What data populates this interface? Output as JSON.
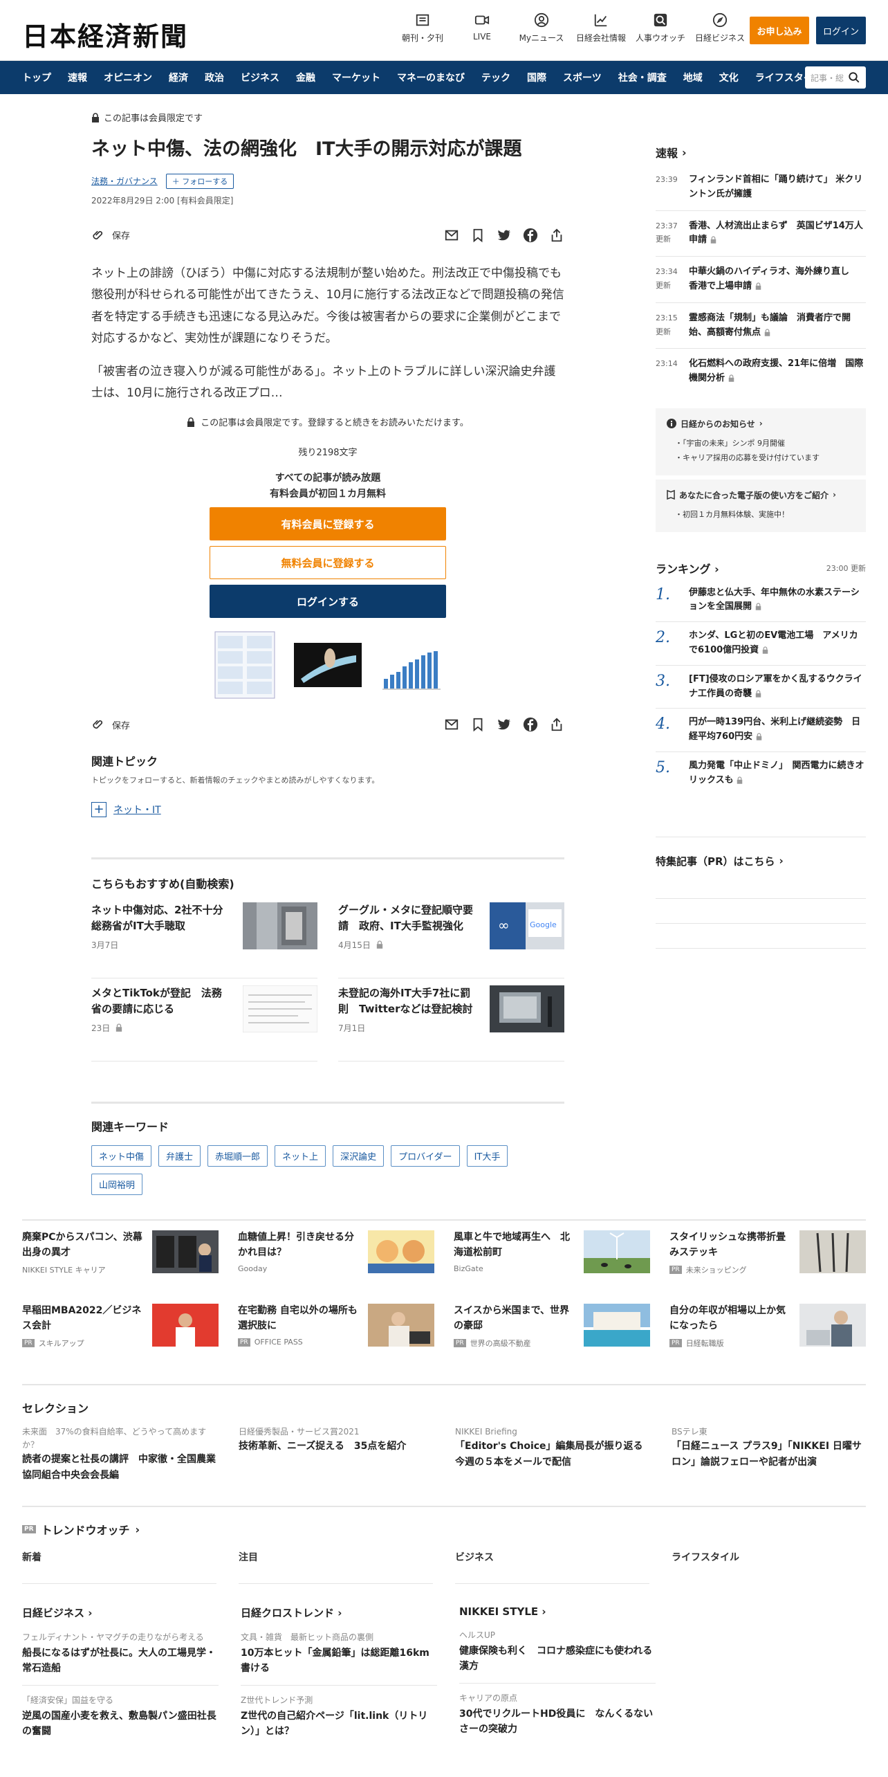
{
  "header": {
    "logo": "日本経済新聞",
    "icons": [
      {
        "icon": "newspaper-icon",
        "label": "朝刊・夕刊"
      },
      {
        "icon": "video-icon",
        "label": "LIVE"
      },
      {
        "icon": "user-icon",
        "label": "Myニュース"
      },
      {
        "icon": "chart-icon",
        "label": "日経会社情報"
      },
      {
        "icon": "search-person-icon",
        "label": "人事ウオッチ"
      },
      {
        "icon": "compass-icon",
        "label": "日経ビジネス"
      }
    ],
    "subscribe_label": "お申し込み",
    "login_label": "ログイン"
  },
  "nav": {
    "items": [
      "トップ",
      "速報",
      "オピニオン",
      "経済",
      "政治",
      "ビジネス",
      "金融",
      "マーケット",
      "マネーのまなび",
      "テック",
      "国際",
      "スポーツ",
      "社会・調査",
      "地域",
      "文化",
      "ライフスタイル"
    ],
    "search_placeholder": "記事・総"
  },
  "article": {
    "members_label": "この記事は会員限定です",
    "title": "ネット中傷、法の網強化　IT大手の開示対応が課題",
    "tag": "法務・ガバナンス",
    "follow_label": "フォローする",
    "date": "2022年8月29日 2:00 [有料会員限定]",
    "save_label": "保存",
    "para1": "ネット上の誹謗（ひぼう）中傷に対応する法規制が整い始めた。刑法改正で中傷投稿でも懲役刑が科せられる可能性が出てきたうえ、10月に施行する法改正などで問題投稿の発信者を特定する手続きも迅速になる見込みだ。今後は被害者からの要求に企業側がどこまで対応するかなど、実効性が課題になりそうだ。",
    "para2": "「被害者の泣き寝入りが減る可能性がある」。ネット上のトラブルに詳しい深沢論史弁護士は、10月に施行される改正プロ…",
    "paywall_note": "この記事は会員限定です。登録すると続きをお読みいただけます。",
    "remaining": "残り2198文字",
    "lead1": "すべての記事が読み放題",
    "lead2": "有料会員が初回１カ月無料",
    "btn_paid": "有料会員に登録する",
    "btn_free": "無料会員に登録する",
    "btn_login": "ログインする"
  },
  "topics": {
    "heading": "関連トピック",
    "desc": "トピックをフォローすると、新着情報のチェックやまとめ読みがしやすくなります。",
    "item": "ネット・IT"
  },
  "recommend": {
    "heading": "こちらもおすすめ(自動検索)",
    "items": [
      {
        "title": "ネット中傷対応、2社不十分　総務省がIT大手聴取",
        "date": "3月7日",
        "lock": false
      },
      {
        "title": "グーグル・メタに登記順守要請　政府、IT大手監視強化",
        "date": "4月15日",
        "lock": true
      },
      {
        "title": "メタとTikTokが登記　法務省の要請に応じる",
        "date": "23日",
        "lock": true
      },
      {
        "title": "未登記の海外IT大手7社に罰則　Twitterなどは登記検討",
        "date": "7月1日",
        "lock": false
      }
    ]
  },
  "keywords": {
    "heading": "関連キーワード",
    "items": [
      "ネット中傷",
      "弁護士",
      "赤堀順一郎",
      "ネット上",
      "深沢論史",
      "プロバイダー",
      "IT大手",
      "山岡裕明"
    ]
  },
  "sidebar": {
    "breaking_heading": "速報",
    "news": [
      {
        "time": "23:39",
        "updated": "",
        "title": "フィンランド首相に「踊り続けて」 米クリントン氏が擁護",
        "lock": false
      },
      {
        "time": "23:37",
        "updated": "更新",
        "title": "香港、人材流出止まらず　英国ビザ14万人申請",
        "lock": true
      },
      {
        "time": "23:34",
        "updated": "更新",
        "title": "中華火鍋のハイディラオ、海外練り直し　香港で上場申請",
        "lock": true
      },
      {
        "time": "23:15",
        "updated": "更新",
        "title": "霊感商法「規制」も議論　消費者庁で開始、高額寄付焦点",
        "lock": true
      },
      {
        "time": "23:14",
        "updated": "",
        "title": "化石燃料への政府支援、21年に倍増　国際機関分析",
        "lock": true
      }
    ],
    "notice_heading": "日経からのお知らせ",
    "notices": [
      "「宇宙の未来」シンポ 9月開催",
      "キャリア採用の応募を受け付けています"
    ],
    "epaper_heading": "あなたに合った電子版の使い方をご紹介",
    "epaper_items": [
      "初回１カ月無料体験、実施中！"
    ],
    "ranking_heading": "ランキング",
    "ranking_time": "23:00  更新",
    "ranking": [
      {
        "n": "1.",
        "title": "伊藤忠と仏大手、年中無休の水素ステーションを全国展開"
      },
      {
        "n": "2.",
        "title": "ホンダ、LGと初のEV電池工場　アメリカで6100億円投資"
      },
      {
        "n": "3.",
        "title": "[FT]侵攻のロシア軍をかく乱するウクライナ工作員の奇襲"
      },
      {
        "n": "4.",
        "title": "円が一時139円台、米利上げ継続姿勢　日経平均760円安"
      },
      {
        "n": "5.",
        "title": "風力発電「中止ドミノ」　関西電力に続きオリックスも"
      }
    ],
    "pr_heading": "特集記事（PR）はこちら"
  },
  "promos": [
    {
      "title": "廃棄PCからスパコン、渋幕出身の異才",
      "source": "NIKKEI STYLE キャリア",
      "pr": false
    },
    {
      "title": "血糖値上昇！引き戻せる分かれ目は？",
      "source": "Gooday",
      "pr": false
    },
    {
      "title": "風車と牛で地域再生へ　北海道松前町",
      "source": "BizGate",
      "pr": false
    },
    {
      "title": "スタイリッシュな携帯折畳みステッキ",
      "source": "未来ショッピング",
      "pr": true
    },
    {
      "title": "早稲田MBA2022／ビジネス会計",
      "source": "スキルアップ",
      "pr": true
    },
    {
      "title": "在宅勤務 自宅以外の場所も選択肢に",
      "source": "OFFICE PASS",
      "pr": true
    },
    {
      "title": "スイスから米国まで、世界の豪邸",
      "source": "世界の高級不動産",
      "pr": true
    },
    {
      "title": "自分の年収が相場以上か気になったら",
      "source": "日経転職版",
      "pr": true
    }
  ],
  "selection": {
    "heading": "セレクション",
    "items": [
      {
        "kicker": "未来面　37%の食料自給率、どうやって高めますか？",
        "title": "読者の提案と社長の講評　中家徹・全国農業協同組合中央会会長編"
      },
      {
        "kicker": "日経優秀製品・サービス賞2021",
        "title": "技術革新、ニーズ捉える　35点を紹介"
      },
      {
        "kicker": "NIKKEI Briefing",
        "title": "「Editor's Choice」編集局長が振り返る今週の５本をメールで配信"
      },
      {
        "kicker": "BSテレ東",
        "title": "「日経ニュース プラス9」「NIKKEI 日曜サロン」論説フェローや記者が出演"
      }
    ]
  },
  "trend": {
    "heading": "トレンドウオッチ",
    "cols": [
      "新着",
      "注目",
      "ビジネス",
      "ライフスタイル"
    ]
  },
  "brands": [
    {
      "name": "日経ビジネス",
      "items": [
        {
          "kicker": "フェルディナント・ヤマグチの走りながら考える",
          "title": "船長になるはずが社長に。大人の工場見学・常石造船"
        },
        {
          "kicker": "「経済安保」国益を守る",
          "title": "逆風の国産小麦を救え、敷島製パン盛田社長の奮闘"
        }
      ]
    },
    {
      "name": "日経クロストレンド",
      "items": [
        {
          "kicker": "文具・雑貨　最新ヒット商品の裏側",
          "title": "10万本ヒット「金属鉛筆」は総距離16km書ける"
        },
        {
          "kicker": "Z世代トレンド予測",
          "title": "Z世代の自己紹介ページ「lit.link（リトリン）」とは？"
        }
      ]
    },
    {
      "name": "NIKKEI STYLE",
      "items": [
        {
          "kicker": "ヘルスUP",
          "title": "健康保険も利く　コロナ感染症にも使われる漢方"
        },
        {
          "kicker": "キャリアの原点",
          "title": "30代でリクルートHD役員に　なんくるないさーの突破力"
        }
      ]
    }
  ]
}
